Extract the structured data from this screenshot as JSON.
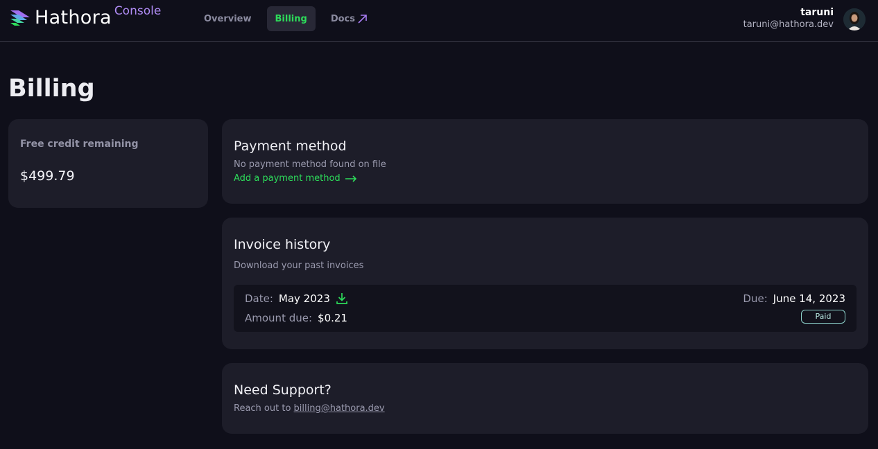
{
  "header": {
    "brand": "Hathora",
    "product": "Console",
    "nav": [
      {
        "label": "Overview",
        "active": false
      },
      {
        "label": "Billing",
        "active": true
      },
      {
        "label": "Docs",
        "active": false
      }
    ],
    "user": {
      "name": "taruni",
      "email": "taruni@hathora.dev"
    }
  },
  "page": {
    "title": "Billing"
  },
  "credit": {
    "label": "Free credit remaining",
    "value": "$499.79"
  },
  "payment": {
    "title": "Payment method",
    "subtitle": "No payment method found on file",
    "link": "Add a payment method"
  },
  "invoices": {
    "title": "Invoice history",
    "subtitle": "Download your past invoices",
    "items": [
      {
        "date_label": "Date:",
        "date": "May 2023",
        "amount_label": "Amount due:",
        "amount": "$0.21",
        "due_label": "Due:",
        "due": "June 14, 2023",
        "status": "Paid"
      }
    ]
  },
  "support": {
    "title": "Need Support?",
    "text": "Reach out to",
    "email": "billing@hathora.dev"
  },
  "colors": {
    "accent": "#2ddc5a",
    "brand_purple": "#b08cf5",
    "background": "#0f0f1a",
    "card": "#1d1d29"
  }
}
